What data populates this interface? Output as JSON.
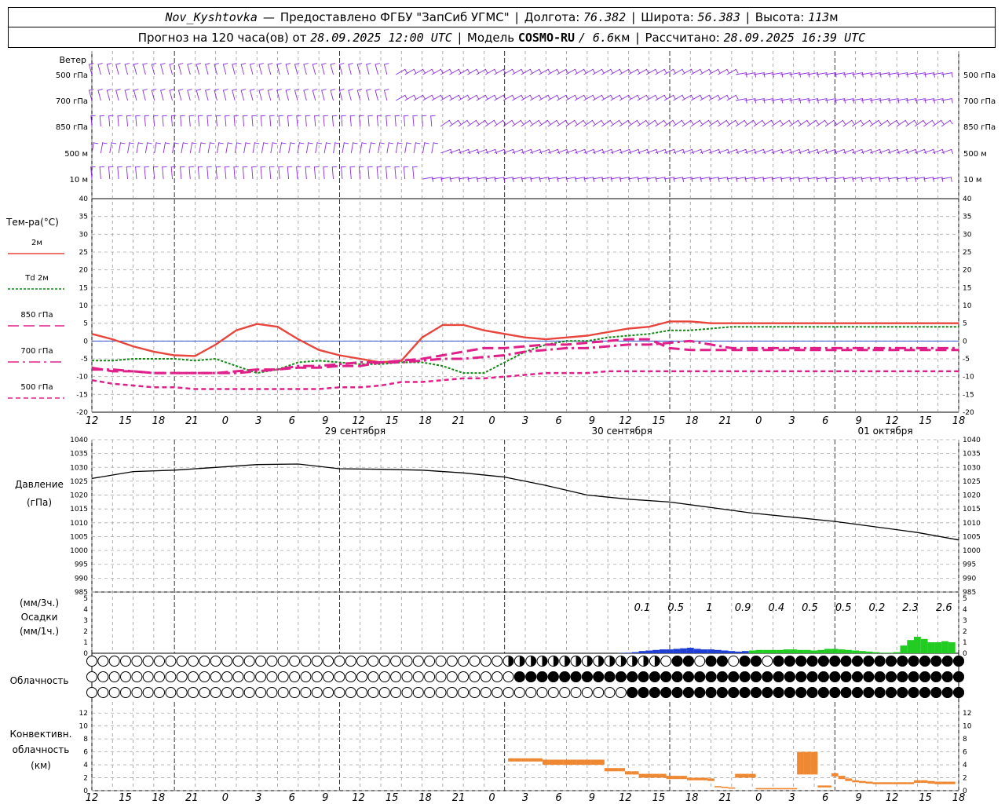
{
  "header": {
    "station": "Nov_Kyshtovka",
    "dash": "—",
    "provider": "Предоставлено ФГБУ \"ЗапСиб УГМС\"",
    "lon_label": "Долгота:",
    "lon_value": "76.382",
    "lat_label": "Широта:",
    "lat_value": "56.383",
    "alt_label": "Высота:",
    "alt_value": "113",
    "alt_unit": "м",
    "forecast_prefix": "Прогноз на 120 часа(ов) от",
    "forecast_start": "28.09.2025 12:00 UTC",
    "model_label": "Модель",
    "model_name": "COSMO-RU",
    "model_res": "/ 6.6",
    "model_res_unit": "км",
    "calc_label": "Рассчитано:",
    "calc_value": "28.09.2025 16:39 UTC"
  },
  "colors": {
    "wind": "#8a2be2",
    "t2m": "#e8453c",
    "td2m": "#118811",
    "t850": "#e0208a",
    "t700": "#e0208a",
    "t500": "#e0208a",
    "pressure": "#000000",
    "precip_3h": "#1f3fd4",
    "precip_1h": "#22cc22",
    "convective": "#ee8833",
    "zero_line": "#3355cc",
    "grid": "#aaaaaa"
  },
  "time_axis": {
    "hour_labels": [
      "12",
      "15",
      "18",
      "21",
      "0",
      "3",
      "6",
      "9",
      "12",
      "15",
      "18",
      "21",
      "0",
      "3",
      "6",
      "9",
      "12",
      "15",
      "18",
      "21",
      "0",
      "3",
      "6",
      "9",
      "12",
      "15",
      "18"
    ],
    "date_labels": [
      "29 сентября",
      "30 сентября",
      "01 октября"
    ]
  },
  "wind": {
    "title": "Ветер",
    "levels": [
      "500 гПа",
      "700 гПа",
      "850 гПа",
      "500 м",
      "10  м"
    ]
  },
  "temperature": {
    "title": "Тем-ра(°C)",
    "ylim": [
      -20,
      40
    ],
    "ticks": [
      "40",
      "35",
      "30",
      "25",
      "20",
      "15",
      "10",
      "5",
      "0",
      "-5",
      "-10",
      "-15",
      "-20"
    ],
    "legend": [
      "2м",
      "Td  2м",
      "850 гПа",
      "700 гПа",
      "500 гПа"
    ]
  },
  "pressure": {
    "title": "Давление",
    "unit": "(гПа)",
    "ylim": [
      985,
      1040
    ],
    "ticks": [
      "1040",
      "1035",
      "1030",
      "1025",
      "1020",
      "1015",
      "1010",
      "1005",
      "1000",
      "995",
      "990",
      "985"
    ]
  },
  "precip": {
    "label_3h": "(мм/3ч.)",
    "title": "Осадки",
    "label_1h": "(мм/1ч.)",
    "ticks": [
      "5",
      "4",
      "3",
      "2",
      "1",
      "0"
    ],
    "totals": [
      "0.1",
      "0.5",
      "1",
      "0.9",
      "0.4",
      "0.5",
      "0.5",
      "0.2",
      "2.3",
      "2.6"
    ]
  },
  "cloud": {
    "title": "Облачность"
  },
  "convective": {
    "title_1": "Конвективн.",
    "title_2": "облачность",
    "unit": "(км)",
    "ticks": [
      "12",
      "10",
      "8",
      "6",
      "4",
      "2",
      "0"
    ]
  },
  "chart_data": [
    {
      "type": "line",
      "id": "temperature",
      "x_hours": [
        0,
        3,
        6,
        9,
        12,
        15,
        18,
        21,
        24,
        27,
        30,
        33,
        36,
        39,
        42,
        45,
        48,
        51,
        54,
        57,
        60,
        63,
        66,
        69,
        72,
        75,
        78,
        81,
        84,
        87,
        90,
        93,
        96,
        99,
        102,
        105,
        108,
        111,
        114,
        117,
        120,
        123,
        126
      ],
      "ylim": [
        -20,
        40
      ],
      "series": [
        {
          "name": "2м",
          "values": [
            2,
            0.5,
            -1.5,
            -3,
            -4,
            -4.2,
            -1,
            3,
            4.8,
            4,
            0.5,
            -2.5,
            -4,
            -5,
            -6,
            -5.5,
            1,
            4.5,
            4.5,
            3,
            2,
            1,
            0.5,
            1,
            1.5,
            2.5,
            3.5,
            4,
            5.5,
            5.5,
            5,
            5,
            5,
            5,
            5,
            5,
            5,
            5,
            5,
            5,
            5,
            5,
            5
          ]
        },
        {
          "name": "Td  2м",
          "values": [
            -5.5,
            -5.5,
            -5,
            -5,
            -5,
            -5.5,
            -5,
            -7,
            -9,
            -8,
            -6,
            -5.5,
            -6,
            -6.5,
            -6.5,
            -6,
            -6,
            -7,
            -9,
            -9,
            -6,
            -3,
            -1,
            0,
            0,
            1,
            1.5,
            2,
            3,
            3,
            3.5,
            4,
            4,
            4,
            4,
            4,
            4,
            4,
            4,
            4,
            4,
            4,
            4
          ]
        },
        {
          "name": "850 гПа",
          "values": [
            -7.5,
            -8.5,
            -8.5,
            -9,
            -9,
            -9,
            -9,
            -8.5,
            -8,
            -8,
            -7.5,
            -7.5,
            -7,
            -7,
            -6,
            -5.5,
            -5,
            -4,
            -3,
            -2,
            -2,
            -1.5,
            -1,
            -1,
            -0.5,
            0,
            0.5,
            0.5,
            -2,
            -2.5,
            -2.5,
            -2.5,
            -2.5,
            -2.5,
            -2.5,
            -2.5,
            -2.5,
            -2.5,
            -2.5,
            -2.5,
            -2.5,
            -2.5,
            -2.5
          ]
        },
        {
          "name": "700 гПа",
          "values": [
            -8,
            -8,
            -8.5,
            -9,
            -9,
            -9,
            -9,
            -9,
            -8.5,
            -8,
            -7,
            -7,
            -6.5,
            -6,
            -6,
            -6,
            -5.5,
            -5,
            -5,
            -4.5,
            -4,
            -3,
            -2.5,
            -2,
            -2,
            -1.5,
            -1,
            -1,
            -0.5,
            0,
            -1,
            -2,
            -2,
            -2,
            -2,
            -2,
            -2,
            -2,
            -2,
            -2,
            -2,
            -2,
            -2
          ]
        },
        {
          "name": "500 гПа",
          "values": [
            -11,
            -12,
            -12.5,
            -13,
            -13,
            -13.5,
            -13.5,
            -13.5,
            -13.5,
            -13.5,
            -13.5,
            -13.5,
            -13,
            -13,
            -12.5,
            -11.5,
            -11.5,
            -11,
            -10.5,
            -10.5,
            -10,
            -9.5,
            -9,
            -9,
            -9,
            -8.5,
            -8.5,
            -8.5,
            -8.5,
            -8.5,
            -8.5,
            -8.5,
            -8.5,
            -8.5,
            -8.5,
            -8.5,
            -8.5,
            -8.5,
            -8.5,
            -8.5,
            -8.5,
            -8.5,
            -8.5
          ]
        }
      ]
    },
    {
      "type": "line",
      "id": "pressure",
      "x_hours": [
        0,
        6,
        12,
        18,
        24,
        30,
        36,
        42,
        48,
        54,
        60,
        66,
        72,
        78,
        84,
        90,
        96,
        102,
        108,
        114,
        120,
        126
      ],
      "ylim": [
        985,
        1040
      ],
      "series": [
        {
          "name": "Давление",
          "values": [
            1026,
            1028.5,
            1029,
            1030,
            1031,
            1031.2,
            1029.5,
            1029.3,
            1029,
            1028,
            1026.5,
            1023.5,
            1020,
            1018.5,
            1017.5,
            1015.5,
            1013.5,
            1012,
            1010.5,
            1008.5,
            1006.5,
            1003.8
          ]
        }
      ]
    },
    {
      "type": "bar",
      "id": "precipitation",
      "x_hours": [
        77,
        78,
        79,
        80,
        81,
        82,
        83,
        84,
        85,
        86,
        87,
        88,
        89,
        90,
        91,
        92,
        93,
        94,
        95,
        96,
        97,
        98,
        99,
        100,
        101,
        102,
        103,
        104,
        105,
        106,
        107,
        108,
        109,
        110,
        111,
        112,
        113,
        114,
        115,
        116,
        117,
        118,
        119,
        120,
        121,
        122,
        123,
        124,
        125
      ],
      "values": [
        0.02,
        0.05,
        0.1,
        0.2,
        0.25,
        0.3,
        0.35,
        0.35,
        0.4,
        0.45,
        0.5,
        0.4,
        0.35,
        0.35,
        0.3,
        0.25,
        0.2,
        0.15,
        0.2,
        0.25,
        0.3,
        0.3,
        0.3,
        0.3,
        0.35,
        0.35,
        0.3,
        0.3,
        0.25,
        0.3,
        0.4,
        0.4,
        0.35,
        0.3,
        0.25,
        0.2,
        0.15,
        0.1,
        0.05,
        0.05,
        0.1,
        0.7,
        1.2,
        1.5,
        1.3,
        1.0,
        1.0,
        1.1,
        1.0
      ],
      "ylim": [
        0,
        5
      ]
    },
    {
      "type": "bar",
      "id": "convective_cloud",
      "x_hours": [
        61,
        62,
        63,
        64,
        65,
        66,
        67,
        68,
        69,
        70,
        71,
        72,
        73,
        74,
        75,
        76,
        77,
        78,
        79,
        80,
        81,
        82,
        83,
        84,
        85,
        86,
        87,
        88,
        89,
        90,
        91,
        92,
        93,
        94,
        95,
        96,
        97,
        98,
        99,
        100,
        101,
        102,
        103,
        104,
        105,
        106,
        107,
        108,
        109,
        110,
        111,
        112,
        113,
        114,
        115,
        116,
        117,
        118,
        119,
        120,
        121,
        122,
        123,
        124,
        125
      ],
      "bottom": [
        4.5,
        4.5,
        4.5,
        4.5,
        4.5,
        4,
        4,
        4,
        4,
        4,
        4,
        4,
        4,
        4,
        3,
        3,
        3,
        2.5,
        2.5,
        2,
        2,
        2,
        2,
        1.8,
        1.8,
        1.8,
        1.6,
        1.6,
        1.6,
        1.5,
        0.5,
        0.4,
        0.3,
        2,
        2,
        2,
        0.2,
        0.2,
        0.2,
        0.2,
        0.2,
        0.2,
        2.5,
        2.5,
        2.5,
        0.5,
        0.5,
        2.2,
        1.8,
        1.5,
        1.3,
        1.2,
        1.1,
        1,
        1,
        1,
        1,
        1,
        1,
        1.2,
        1.2,
        1.1,
        1,
        1,
        1
      ],
      "top": [
        5,
        5,
        5,
        5,
        5,
        4.8,
        4.8,
        4.8,
        4.8,
        4.8,
        4.8,
        4.8,
        4.8,
        4.8,
        3.5,
        3.5,
        3.5,
        3,
        3,
        2.6,
        2.6,
        2.6,
        2.6,
        2.3,
        2.3,
        2.3,
        2,
        2,
        2,
        1.9,
        0.7,
        0.6,
        0.5,
        2.6,
        2.6,
        2.6,
        0.4,
        0.4,
        0.4,
        0.4,
        0.4,
        0.4,
        6,
        6,
        6,
        0.8,
        0.8,
        2.7,
        2.3,
        1.9,
        1.6,
        1.5,
        1.4,
        1.3,
        1.3,
        1.3,
        1.3,
        1.3,
        1.3,
        1.6,
        1.6,
        1.5,
        1.4,
        1.4,
        1.4
      ],
      "ylim": [
        0,
        13
      ]
    }
  ]
}
